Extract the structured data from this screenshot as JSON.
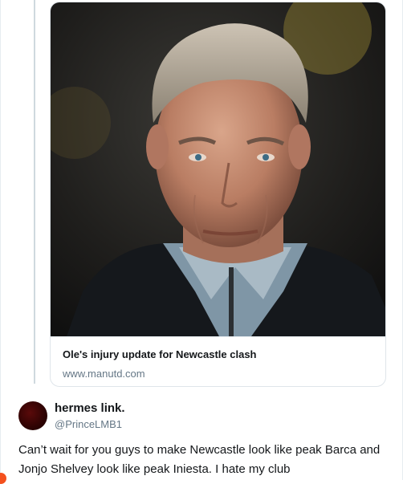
{
  "link_card": {
    "image_name": "portrait-photo",
    "title": "Ole's injury update for Newcastle clash",
    "domain": "www.manutd.com"
  },
  "reply": {
    "display_name": "hermes link.",
    "handle": "@PrinceLMB1",
    "text": "Can’t wait for you guys to make Newcastle look like peak Barca and Jonjo Shelvey look like peak Iniesta. I hate my club"
  },
  "colors": {
    "secondary_text": "#657786",
    "border": "#e6ecf0",
    "avatar": "#3a0505",
    "notification_dot": "#f4511e"
  }
}
